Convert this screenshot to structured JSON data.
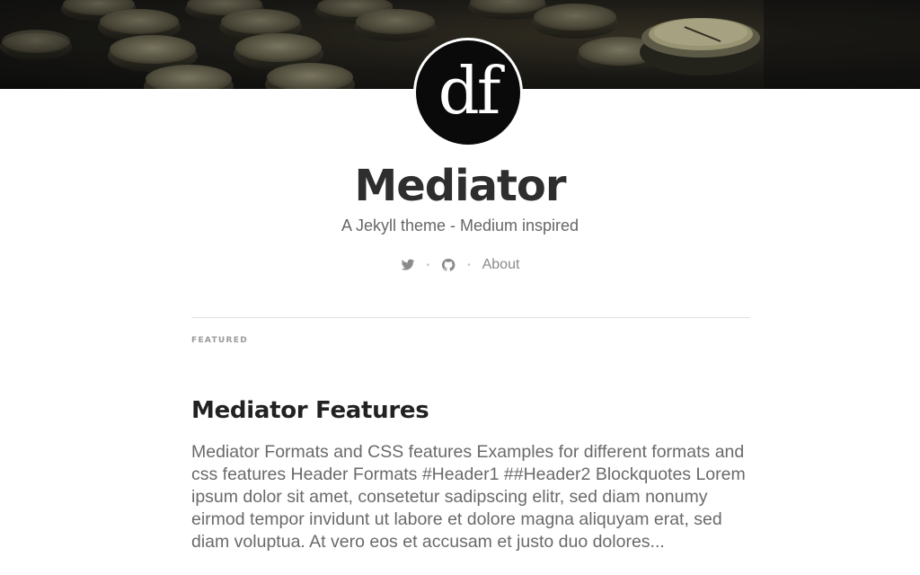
{
  "header": {
    "logo_text": "df",
    "title": "Mediator",
    "tagline": "A Jekyll theme - Medium inspired"
  },
  "nav": {
    "items": [
      {
        "type": "icon",
        "icon": "twitter-icon"
      },
      {
        "type": "icon",
        "icon": "github-icon"
      },
      {
        "type": "link",
        "label": "About"
      }
    ],
    "separator": "•"
  },
  "main": {
    "section_label": "FEATURED",
    "posts": [
      {
        "title": "Mediator Features",
        "excerpt": "Mediator Formats and CSS features Examples for different formats and css features Header Formats #Header1 ##Header2 Blockquotes Lorem ipsum dolor sit amet, consetetur sadipscing elitr, sed diam nonumy eirmod tempor invidunt ut labore et dolore magna aliquyam erat, sed diam voluptua. At vero eos et accusam et justo duo dolores..."
      }
    ]
  },
  "colors": {
    "title": "#2e2e2e",
    "tagline": "#666666",
    "nav": "#8a8a8a",
    "rule": "#e2e2e2",
    "logo_bg": "#0a0a0a"
  }
}
